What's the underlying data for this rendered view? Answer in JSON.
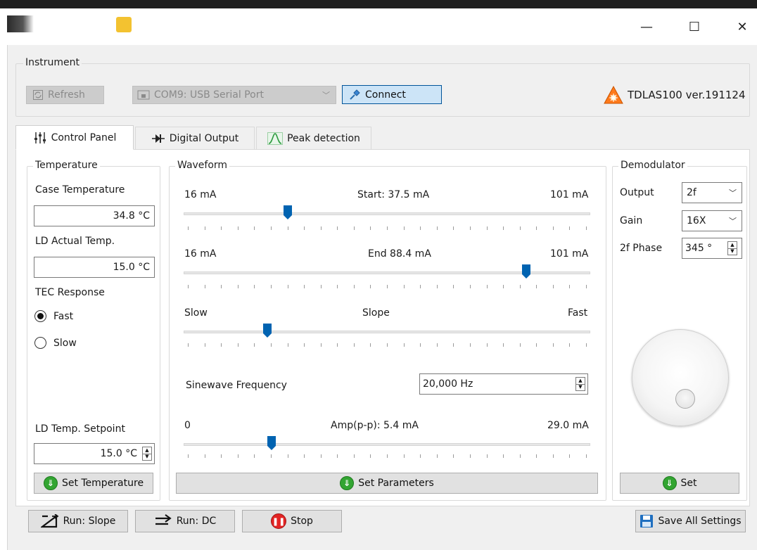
{
  "window": {
    "minimize": "—",
    "maximize": "☐",
    "close": "✕"
  },
  "instrument": {
    "group_title": "Instrument",
    "refresh_label": "Refresh",
    "port_value": "COM9: USB Serial Port",
    "connect_label": "Connect",
    "version": "TDLAS100 ver.191124"
  },
  "tabs": [
    {
      "label": "Control Panel",
      "active": true
    },
    {
      "label": "Digital Output",
      "active": false
    },
    {
      "label": "Peak detection",
      "active": false
    }
  ],
  "temperature": {
    "group_title": "Temperature",
    "case_label": "Case Temperature",
    "case_value": "34.8 °C",
    "ld_actual_label": "LD Actual Temp.",
    "ld_actual_value": "15.0 °C",
    "tec_label": "TEC Response",
    "fast_label": "Fast",
    "slow_label": "Slow",
    "tec_selected": "Fast",
    "setpoint_label": "LD Temp. Setpoint",
    "setpoint_value": "15.0 °C",
    "set_button": "Set Temperature"
  },
  "waveform": {
    "group_title": "Waveform",
    "start": {
      "min": "16 mA",
      "label": "Start:  37.5 mA",
      "max": "101 mA",
      "fraction": 0.25
    },
    "end": {
      "min": "16 mA",
      "label": "End  88.4 mA",
      "max": "101 mA",
      "fraction": 0.85
    },
    "slope": {
      "min": "Slow",
      "label": "Slope",
      "max": "Fast",
      "fraction": 0.2
    },
    "sinewave_label": "Sinewave Frequency",
    "sinewave_value": "20,000 Hz",
    "amp": {
      "min": "0",
      "label": "Amp(p-p):  5.4 mA",
      "max": "29.0 mA",
      "fraction": 0.21
    },
    "set_button": "Set Parameters"
  },
  "demodulator": {
    "group_title": "Demodulator",
    "output_label": "Output",
    "output_value": "2f",
    "gain_label": "Gain",
    "gain_value": "16X",
    "phase_label": "2f Phase",
    "phase_value": "345 °",
    "set_button": "Set"
  },
  "bottom": {
    "run_slope": "Run: Slope",
    "run_dc": "Run: DC",
    "stop": "Stop",
    "save_all": "Save All Settings"
  },
  "colors": {
    "accent": "#0063b1",
    "connect_bg": "#cce4f7",
    "green": "#33a532",
    "red": "#e32424"
  }
}
